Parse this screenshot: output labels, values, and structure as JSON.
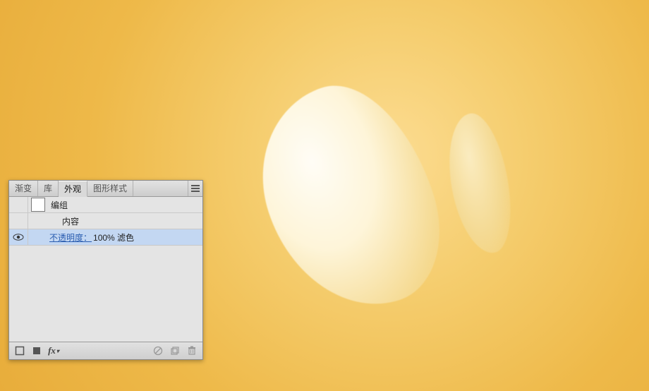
{
  "tabs": {
    "gradient": "渐变",
    "library": "库",
    "appearance": "外观",
    "graphicStyles": "图形样式"
  },
  "rows": {
    "group": "编组",
    "contents": "内容",
    "opacity_label": "不透明度：",
    "opacity_value": "100% 滤色"
  }
}
